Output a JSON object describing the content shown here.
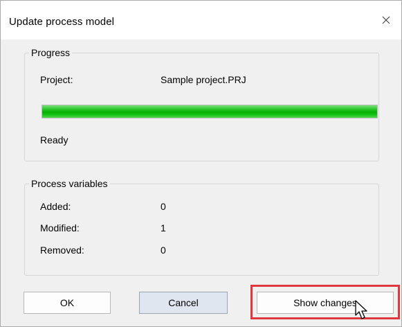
{
  "window": {
    "title": "Update process model",
    "close_glyph": "✕"
  },
  "progress_group": {
    "legend": "Progress",
    "project_label": "Project:",
    "project_value": "Sample project.PRJ",
    "progress_fraction": 1.0,
    "progress_color": "#06b006",
    "status": "Ready"
  },
  "variables_group": {
    "legend": "Process variables",
    "rows": [
      {
        "label": "Added:",
        "value": "0"
      },
      {
        "label": "Modified:",
        "value": "1"
      },
      {
        "label": "Removed:",
        "value": "0"
      }
    ]
  },
  "buttons": {
    "ok": "OK",
    "cancel": "Cancel",
    "show_changes": "Show changes"
  },
  "annotation": {
    "highlight_color": "#e0373c",
    "cursor_icon": "arrow-pointer-icon"
  }
}
